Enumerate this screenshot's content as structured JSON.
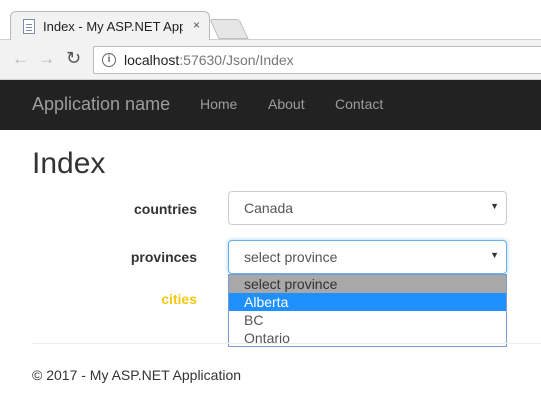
{
  "browser": {
    "tab_title": "Index - My ASP.NET Appl",
    "tab_close": "×",
    "url_host": "localhost",
    "url_rest": ":57630/Json/Index"
  },
  "icons": {
    "back": "arrow-left-icon",
    "forward": "arrow-right-icon",
    "reload": "reload-icon",
    "info": "info-icon",
    "dropdown_arrow": "caret-down-icon"
  },
  "navbar": {
    "brand": "Application name",
    "links": [
      "Home",
      "About",
      "Contact"
    ]
  },
  "page": {
    "title": "Index"
  },
  "form": {
    "countries": {
      "label": "countries",
      "value": "Canada"
    },
    "provinces": {
      "label": "provinces",
      "value": "select province",
      "options": [
        "select province",
        "Alberta",
        "BC",
        "Ontario"
      ],
      "highlighted": "Alberta"
    },
    "cities": {
      "label": "cities"
    }
  },
  "footer": {
    "text": "© 2017 - My ASP.NET Application"
  },
  "colors": {
    "navbar_bg": "#222222",
    "navbar_text": "#9d9d9d",
    "cities_label": "#f2c811",
    "option_highlight": "#1e90ff",
    "focus_border": "#66afe9"
  }
}
